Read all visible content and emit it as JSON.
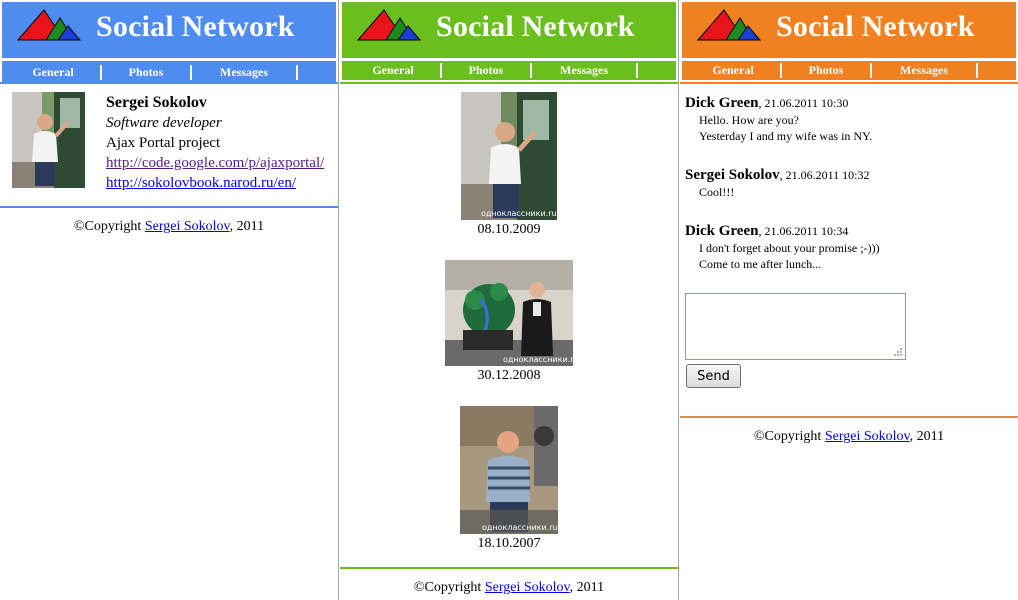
{
  "app": {
    "title": "Social Network"
  },
  "nav": {
    "general": "General",
    "photos": "Photos",
    "messages": "Messages"
  },
  "colors": {
    "blue": "#4f8cf0",
    "green": "#6abf1e",
    "orange": "#f08020"
  },
  "profile": {
    "name": "Sergei Sokolov",
    "job": "Software developer",
    "project": "Ajax Portal project",
    "link1": "http://code.google.com/p/ajaxportal/",
    "link2": "http://sokolovbook.narod.ru/en/"
  },
  "photos": [
    {
      "date": "08.10.2009",
      "watermark": "одноклассники.ru"
    },
    {
      "date": "30.12.2008",
      "watermark": "одноклассники.ru"
    },
    {
      "date": "18.10.2007",
      "watermark": "одноклассники.ru"
    }
  ],
  "messages": [
    {
      "author": "Dick Green",
      "date": ", 21.06.2011 10:30",
      "lines": [
        "Hello. How are you?",
        "Yesterday I and my wife was in NY."
      ]
    },
    {
      "author": "Sergei Sokolov",
      "date": ", 21.06.2011 10:32",
      "lines": [
        "Cool!!!"
      ]
    },
    {
      "author": "Dick Green",
      "date": ", 21.06.2011 10:34",
      "lines": [
        "I don't forget about your promise ;-)))",
        "Come to me after lunch..."
      ]
    }
  ],
  "compose": {
    "send_label": "Send",
    "placeholder": ""
  },
  "footer": {
    "prefix": "©Copyright ",
    "link": "Sergei Sokolov",
    "suffix": ", 2011"
  }
}
